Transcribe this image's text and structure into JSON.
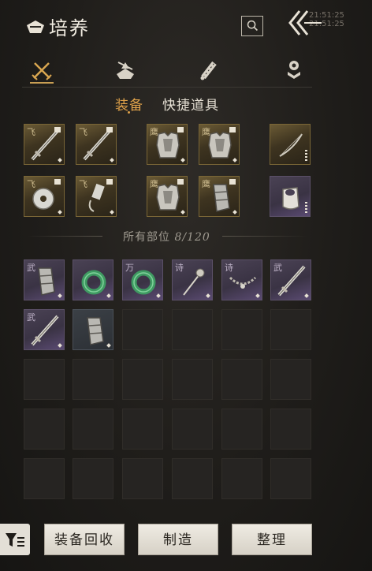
{
  "header": {
    "title": "培养",
    "clock": "21:51:25 21:51:25",
    "icons": {
      "title": "hat-icon",
      "search": "search-icon",
      "back": "double-chevron-left-icon"
    }
  },
  "category_tabs": [
    {
      "name": "weapons",
      "icon": "crossed-swords-icon",
      "active": true
    },
    {
      "name": "outfit",
      "icon": "hat-icon",
      "active": false
    },
    {
      "name": "scroll",
      "icon": "scroll-icon",
      "active": false
    },
    {
      "name": "skills",
      "icon": "badge-icon",
      "active": false
    }
  ],
  "sub_tabs": {
    "equip": "装备",
    "quick_items": "快捷道具",
    "active": "equip"
  },
  "equipped": [
    {
      "mark": "飞",
      "rarity": "gold",
      "item": "sword-icon"
    },
    {
      "mark": "飞",
      "rarity": "gold",
      "item": "sword-icon"
    },
    {
      "mark": "鹰",
      "rarity": "gold",
      "item": "armor-icon"
    },
    {
      "mark": "鹰",
      "rarity": "gold",
      "item": "armor-icon"
    },
    {
      "mark": "",
      "rarity": "gold",
      "item": "bow-icon"
    },
    {
      "mark": "飞",
      "rarity": "gold",
      "item": "jade-disc-icon"
    },
    {
      "mark": "飞",
      "rarity": "gold",
      "item": "pendant-icon"
    },
    {
      "mark": "鹰",
      "rarity": "gold",
      "item": "armor-icon"
    },
    {
      "mark": "鹰",
      "rarity": "gold",
      "item": "bracer-icon"
    },
    {
      "mark": "",
      "rarity": "purple",
      "item": "ring-icon"
    }
  ],
  "inventory_divider": {
    "label": "所有部位",
    "count": "8/120"
  },
  "inventory": [
    {
      "mark": "武",
      "rarity": "purple",
      "item": "bracer-icon"
    },
    {
      "mark": "",
      "rarity": "purple",
      "item": "jade-ring-icon"
    },
    {
      "mark": "万",
      "rarity": "purple",
      "item": "jade-ring-icon"
    },
    {
      "mark": "诗",
      "rarity": "purple",
      "item": "hairpin-icon"
    },
    {
      "mark": "诗",
      "rarity": "purple",
      "item": "necklace-icon"
    },
    {
      "mark": "武",
      "rarity": "purple",
      "item": "sword-icon"
    },
    {
      "mark": "武",
      "rarity": "purple",
      "item": "sword-icon"
    },
    {
      "mark": "",
      "rarity": "dark",
      "item": "bracer-icon"
    }
  ],
  "bottom_bar": {
    "filter_icon": "filter-icon",
    "recycle": "装备回收",
    "craft": "制造",
    "sort": "整理"
  },
  "colors": {
    "accent": "#e0a24a",
    "gold_slot": "#6a5a35",
    "purple_slot": "#4a4254"
  }
}
